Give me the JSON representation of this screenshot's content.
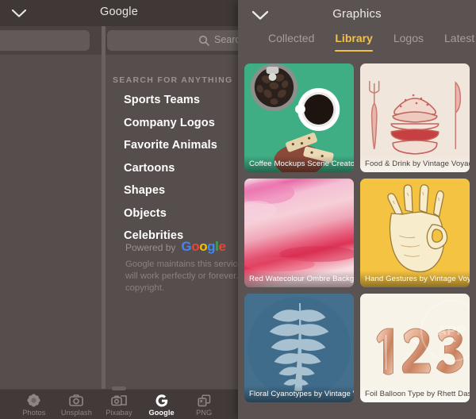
{
  "left_panel": {
    "title": "Google",
    "collapse_icon": "chevron-down-icon",
    "search_placeholder": "Search",
    "search_value": "",
    "search_icon": "search-icon",
    "section_label": "SEARCH FOR ANYTHING",
    "links": [
      "Sports Teams",
      "Company Logos",
      "Favorite Animals",
      "Cartoons",
      "Shapes",
      "Objects",
      "Celebrities"
    ],
    "powered_by_label": "Powered by",
    "google_wordmark": "Google",
    "disclaimer": "Google maintains this service and w\nwill work perfectly or forever. Also, \ncopyright.",
    "tabbar": [
      {
        "label": "Photos",
        "icon": "flower-icon",
        "active": false
      },
      {
        "label": "Unsplash",
        "icon": "camera-icon",
        "active": false
      },
      {
        "label": "Pixabay",
        "icon": "camera-photo-icon",
        "active": false
      },
      {
        "label": "Google",
        "icon": "google-g-icon",
        "active": true
      },
      {
        "label": "PNG",
        "icon": "layers-squares-icon",
        "active": false
      }
    ]
  },
  "right_panel": {
    "title": "Graphics",
    "collapse_icon": "chevron-down-icon",
    "tabs": [
      {
        "label": "Collected",
        "active": false
      },
      {
        "label": "Library",
        "active": true
      },
      {
        "label": "Logos",
        "active": false
      },
      {
        "label": "Latest",
        "active": false
      }
    ],
    "cards": [
      {
        "caption": "Coffee Mockups Scene Creator...",
        "art": "coffee",
        "light": false
      },
      {
        "caption": "Food & Drink by Vintage Voyage",
        "art": "burger",
        "light": true
      },
      {
        "caption": "Red Watecolour Ombre Backgro...",
        "art": "watercolour",
        "light": false
      },
      {
        "caption": "Hand Gestures by Vintage Voya...",
        "art": "hand",
        "light": false
      },
      {
        "caption": "Floral Cyanotypes by Vintage V...",
        "art": "fern",
        "light": false
      },
      {
        "caption": "Foil Balloon Type by Rhett Dash...",
        "art": "balloons",
        "light": true,
        "watermark": "APP"
      }
    ]
  },
  "colors": {
    "accent_yellow": "#f0c14b",
    "panel_bg": "#5b5351",
    "left_bg": "#564e4c",
    "header_bg": "#3f3836",
    "google_blue": "#4285f4",
    "google_red": "#ea4335",
    "google_yellow": "#fbbc05",
    "google_green": "#34a853"
  }
}
